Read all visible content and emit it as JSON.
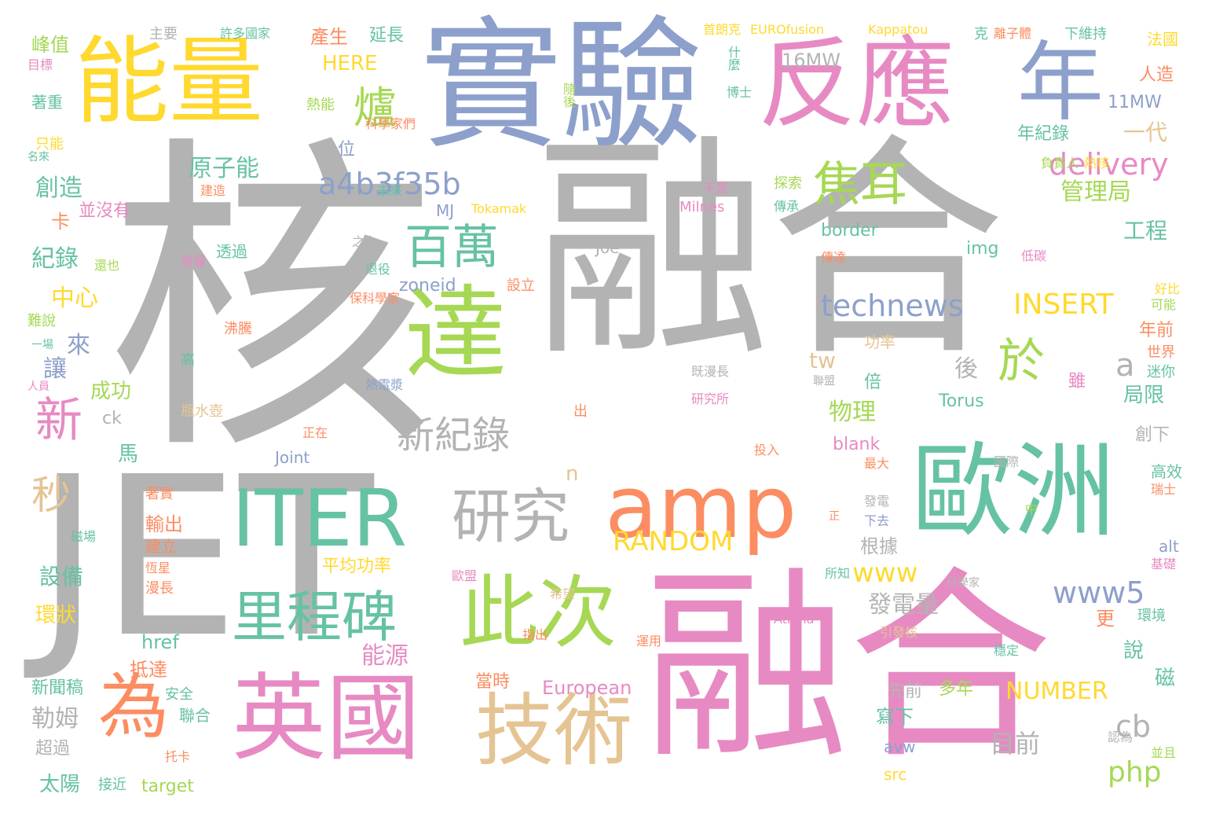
{
  "palette": {
    "gray": "#b3b3b3",
    "blue": "#8da0cb",
    "pink": "#e78ac3",
    "green": "#66c2a5",
    "orange": "#fc8d62",
    "lime": "#a6d854",
    "yellow": "#ffd92f",
    "tan": "#e5c494"
  },
  "words": [
    {
      "text": "核",
      "color": "gray"
    },
    {
      "text": "融合",
      "color": "gray"
    },
    {
      "text": "JET",
      "color": "gray"
    },
    {
      "text": "實驗",
      "color": "blue"
    },
    {
      "text": "融合",
      "color": "pink"
    },
    {
      "text": "能量",
      "color": "yellow"
    },
    {
      "text": "反應",
      "color": "pink"
    },
    {
      "text": "年",
      "color": "blue"
    },
    {
      "text": "達",
      "color": "lime"
    },
    {
      "text": "amp",
      "color": "orange"
    },
    {
      "text": "歐洲",
      "color": "green"
    },
    {
      "text": "英國",
      "color": "pink"
    },
    {
      "text": "技術",
      "color": "tan"
    },
    {
      "text": "為",
      "color": "orange"
    },
    {
      "text": "此次",
      "color": "lime"
    },
    {
      "text": "ITER",
      "color": "green"
    },
    {
      "text": "研究",
      "color": "gray"
    },
    {
      "text": "里程碑",
      "color": "green"
    },
    {
      "text": "百萬",
      "color": "green"
    },
    {
      "text": "焦耳",
      "color": "lime"
    },
    {
      "text": "爐",
      "color": "lime"
    },
    {
      "text": "於",
      "color": "lime"
    },
    {
      "text": "新",
      "color": "pink"
    },
    {
      "text": "秒",
      "color": "tan"
    },
    {
      "text": "新紀錄",
      "color": "gray"
    },
    {
      "text": "a4b3f35b",
      "color": "blue"
    },
    {
      "text": "technews",
      "color": "blue"
    },
    {
      "text": "delivery",
      "color": "pink"
    },
    {
      "text": "INSERT",
      "color": "yellow"
    },
    {
      "text": "RANDOM",
      "color": "yellow"
    },
    {
      "text": "www5",
      "color": "blue"
    },
    {
      "text": "www",
      "color": "yellow"
    },
    {
      "text": "php",
      "color": "lime"
    },
    {
      "text": "cb",
      "color": "gray"
    },
    {
      "text": "NUMBER",
      "color": "yellow"
    },
    {
      "text": "目前",
      "color": "gray"
    },
    {
      "text": "發電量",
      "color": "gray"
    },
    {
      "text": "能源",
      "color": "pink"
    },
    {
      "text": "物理",
      "color": "lime"
    },
    {
      "text": "後",
      "color": "gray"
    },
    {
      "text": "Torus",
      "color": "green"
    },
    {
      "text": "原子能",
      "color": "green"
    },
    {
      "text": "創造",
      "color": "green"
    },
    {
      "text": "紀錄",
      "color": "green"
    },
    {
      "text": "中心",
      "color": "yellow"
    },
    {
      "text": "來",
      "color": "blue"
    },
    {
      "text": "讓",
      "color": "blue"
    },
    {
      "text": "成功",
      "color": "lime"
    },
    {
      "text": "設備",
      "color": "green"
    },
    {
      "text": "勒姆",
      "color": "gray"
    },
    {
      "text": "管理局",
      "color": "lime"
    },
    {
      "text": "工程",
      "color": "green"
    },
    {
      "text": "一代",
      "color": "tan"
    },
    {
      "text": "局限",
      "color": "green"
    },
    {
      "text": "a",
      "color": "gray"
    },
    {
      "text": "tw",
      "color": "tan"
    },
    {
      "text": "HERE",
      "color": "yellow"
    },
    {
      "text": "產生",
      "color": "orange"
    },
    {
      "text": "延長",
      "color": "green"
    },
    {
      "text": "16MW",
      "color": "gray"
    },
    {
      "text": "11MW",
      "color": "blue"
    },
    {
      "text": "年紀錄",
      "color": "green"
    },
    {
      "text": "人造",
      "color": "orange"
    },
    {
      "text": "峰值",
      "color": "lime"
    },
    {
      "text": "目標",
      "color": "pink"
    },
    {
      "text": "著重",
      "color": "green"
    },
    {
      "text": "熱能",
      "color": "lime"
    },
    {
      "text": "科學家們",
      "color": "orange"
    },
    {
      "text": "位",
      "color": "blue"
    },
    {
      "text": "卡",
      "color": "orange"
    },
    {
      "text": "並沒有",
      "color": "pink"
    },
    {
      "text": "MJ",
      "color": "blue"
    },
    {
      "text": "Tokamak",
      "color": "yellow"
    },
    {
      "text": "border",
      "color": "green"
    },
    {
      "text": "img",
      "color": "green"
    },
    {
      "text": "zoneid",
      "color": "blue"
    },
    {
      "text": "Joe",
      "color": "gray"
    },
    {
      "text": "透過",
      "color": "green"
    },
    {
      "text": "平均功率",
      "color": "yellow"
    },
    {
      "text": "根據",
      "color": "gray"
    },
    {
      "text": "馬",
      "color": "green"
    },
    {
      "text": "ck",
      "color": "gray"
    },
    {
      "text": "Joint",
      "color": "blue"
    },
    {
      "text": "blank",
      "color": "pink"
    },
    {
      "text": "n",
      "color": "tan"
    },
    {
      "text": "倍",
      "color": "green"
    },
    {
      "text": "功率",
      "color": "tan"
    },
    {
      "text": "年前",
      "color": "orange"
    },
    {
      "text": "更",
      "color": "orange"
    },
    {
      "text": "說",
      "color": "green"
    },
    {
      "text": "磁",
      "color": "green"
    },
    {
      "text": "alt",
      "color": "blue"
    },
    {
      "text": "環境",
      "color": "green"
    },
    {
      "text": "輸出",
      "color": "orange"
    },
    {
      "text": "建立",
      "color": "orange"
    },
    {
      "text": "環狀",
      "color": "yellow"
    },
    {
      "text": "href",
      "color": "green"
    },
    {
      "text": "抵達",
      "color": "orange"
    },
    {
      "text": "新聞稿",
      "color": "green"
    },
    {
      "text": "聯合",
      "color": "green"
    },
    {
      "text": "超過",
      "color": "gray"
    },
    {
      "text": "太陽",
      "color": "green"
    },
    {
      "text": "target",
      "color": "lime"
    },
    {
      "text": "European",
      "color": "pink"
    },
    {
      "text": "當時",
      "color": "orange"
    },
    {
      "text": "多年",
      "color": "lime"
    },
    {
      "text": "先前",
      "color": "gray"
    },
    {
      "text": "寫下",
      "color": "green"
    },
    {
      "text": "avw",
      "color": "blue"
    },
    {
      "text": "src",
      "color": "yellow"
    },
    {
      "text": "創下",
      "color": "gray"
    },
    {
      "text": "高效",
      "color": "green"
    },
    {
      "text": "世界",
      "color": "orange"
    },
    {
      "text": "迷你",
      "color": "green"
    },
    {
      "text": "主要",
      "color": "gray"
    },
    {
      "text": "許多國家",
      "color": "green"
    },
    {
      "text": "首朗克",
      "color": "yellow"
    },
    {
      "text": "EUROfusion",
      "color": "yellow"
    },
    {
      "text": "Kappatou",
      "color": "yellow"
    },
    {
      "text": "克",
      "color": "green"
    },
    {
      "text": "離子體",
      "color": "orange"
    },
    {
      "text": "下維持",
      "color": "green"
    },
    {
      "text": "法國",
      "color": "yellow"
    },
    {
      "text": "什麼",
      "color": "green"
    },
    {
      "text": "博士",
      "color": "green"
    },
    {
      "text": "負責人",
      "color": "lime"
    },
    {
      "text": "熱核",
      "color": "yellow"
    },
    {
      "text": "探索",
      "color": "lime"
    },
    {
      "text": "傳承",
      "color": "green"
    },
    {
      "text": "不高",
      "color": "pink"
    },
    {
      "text": "Milnes",
      "color": "pink"
    },
    {
      "text": "低碳",
      "color": "pink"
    },
    {
      "text": "傳達",
      "color": "orange"
    },
    {
      "text": "設立",
      "color": "orange"
    },
    {
      "text": "退役",
      "color": "green"
    },
    {
      "text": "保科學家",
      "color": "orange"
    },
    {
      "text": "熱電漿",
      "color": "blue"
    },
    {
      "text": "研究所",
      "color": "pink"
    },
    {
      "text": "既漫長",
      "color": "gray"
    },
    {
      "text": "聯盟",
      "color": "gray"
    },
    {
      "text": "正在",
      "color": "orange"
    },
    {
      "text": "瓶水壺",
      "color": "tan"
    },
    {
      "text": "出",
      "color": "orange"
    },
    {
      "text": "投入",
      "color": "orange"
    },
    {
      "text": "最大",
      "color": "orange"
    },
    {
      "text": "國際",
      "color": "gray"
    },
    {
      "text": "瑞士",
      "color": "orange"
    },
    {
      "text": "發電",
      "color": "gray"
    },
    {
      "text": "下去",
      "color": "blue"
    },
    {
      "text": "所知",
      "color": "green"
    },
    {
      "text": "歐盟",
      "color": "pink"
    },
    {
      "text": "希望",
      "color": "tan"
    },
    {
      "text": "指出",
      "color": "orange"
    },
    {
      "text": "運用",
      "color": "orange"
    },
    {
      "text": "Athina",
      "color": "pink"
    },
    {
      "text": "引發核",
      "color": "tan"
    },
    {
      "text": "穩定",
      "color": "green"
    },
    {
      "text": "認為",
      "color": "gray"
    },
    {
      "text": "並且",
      "color": "lime"
    },
    {
      "text": "基礎",
      "color": "pink"
    },
    {
      "text": "可能",
      "color": "lime"
    },
    {
      "text": "好比",
      "color": "yellow"
    },
    {
      "text": "安全",
      "color": "green"
    },
    {
      "text": "托卡",
      "color": "orange"
    },
    {
      "text": "接近",
      "color": "green"
    },
    {
      "text": "著實",
      "color": "orange"
    },
    {
      "text": "磁場",
      "color": "green"
    },
    {
      "text": "恆星",
      "color": "orange"
    },
    {
      "text": "漫長",
      "color": "orange"
    },
    {
      "text": "難說",
      "color": "lime"
    },
    {
      "text": "一場",
      "color": "green"
    },
    {
      "text": "人員",
      "color": "pink"
    },
    {
      "text": "高",
      "color": "green"
    },
    {
      "text": "沸騰",
      "color": "orange"
    },
    {
      "text": "還也",
      "color": "lime"
    },
    {
      "text": "發展",
      "color": "pink"
    },
    {
      "text": "建造",
      "color": "orange"
    },
    {
      "text": "只能",
      "color": "yellow"
    },
    {
      "text": "名來",
      "color": "green"
    },
    {
      "text": "未來",
      "color": "green"
    },
    {
      "text": "隨後",
      "color": "lime"
    },
    {
      "text": "之上",
      "color": "gray"
    },
    {
      "text": "中",
      "color": "lime"
    },
    {
      "text": "雖",
      "color": "pink"
    },
    {
      "text": "科學家",
      "color": "gray"
    },
    {
      "text": "正",
      "color": "orange"
    }
  ]
}
